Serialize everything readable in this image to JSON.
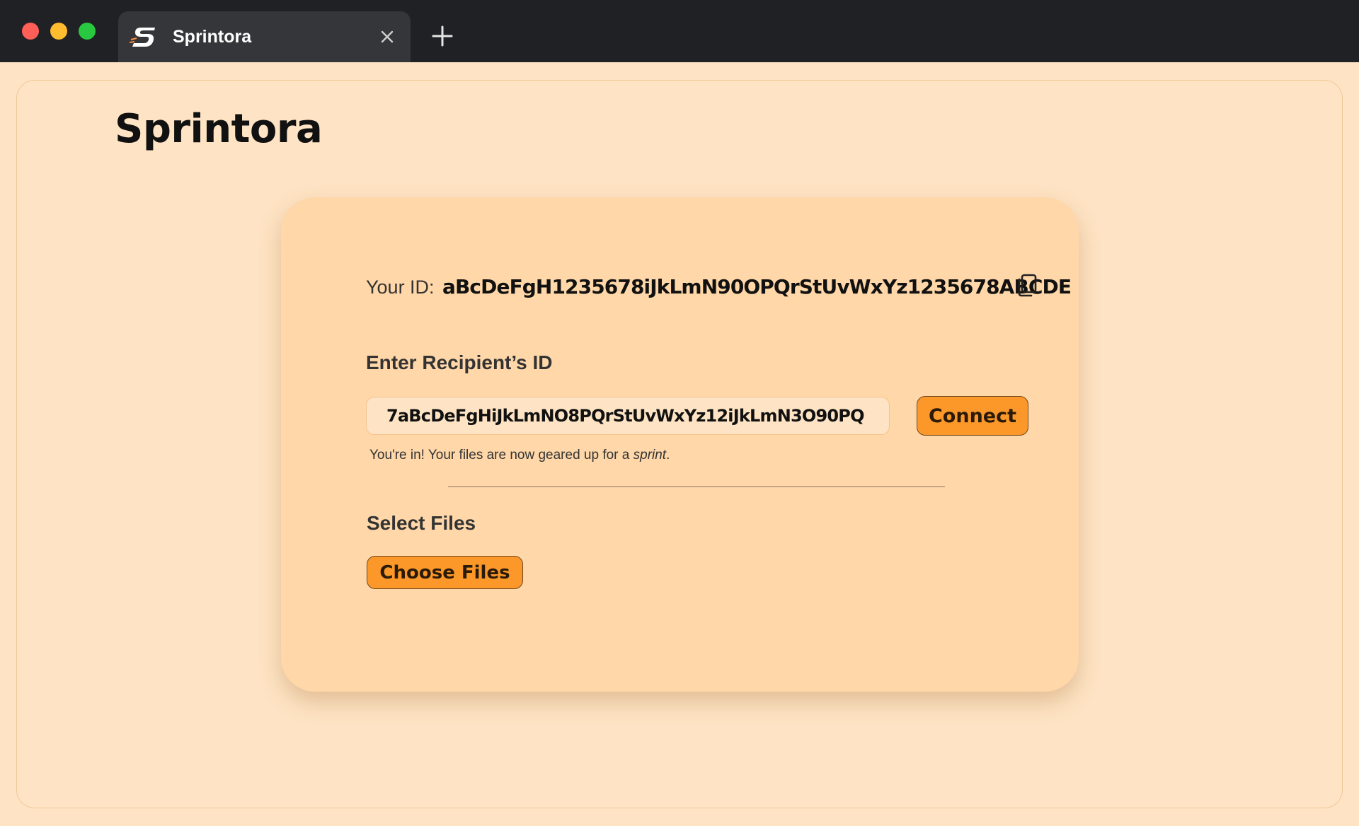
{
  "browser": {
    "tab_title": "Sprintora",
    "favicon": "sprintora-logo-icon",
    "close_icon": "close-icon",
    "new_tab_icon": "plus-icon"
  },
  "app": {
    "title": "Sprintora"
  },
  "card": {
    "id_label": "Your ID:",
    "id_value": "aBcDeFgH1235678iJkLmN90OPQrStUvWxYz1235678ABCDE",
    "copy_icon": "copy-icon",
    "recipient_label": "Enter Recipient’s ID",
    "recipient_value": "7aBcDeFgHiJkLmNO8PQrStUvWxYz12iJkLmN3O90PQ",
    "connect_label": "Connect",
    "status_prefix": "You're in! Your files are now geared up for a ",
    "status_emphasis": "sprint",
    "status_suffix": ".",
    "select_label": "Select Files",
    "choose_label": "Choose Files"
  },
  "colors": {
    "page_bg": "#fee4c4",
    "card_bg": "#ffd7a8",
    "accent": "#fc982a",
    "titlebar": "#202124",
    "tab": "#35363a"
  }
}
